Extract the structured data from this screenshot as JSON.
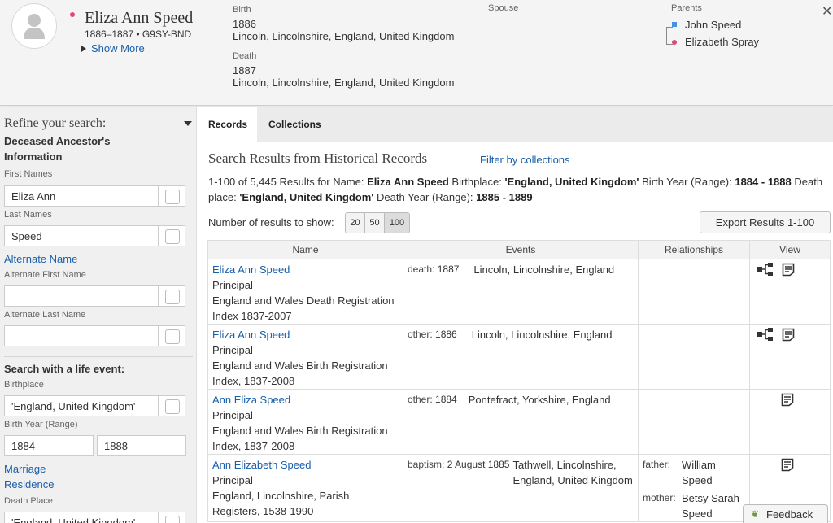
{
  "person": {
    "name": "Eliza Ann Speed",
    "meta": "1886–1887 • G9SY-BND",
    "show_more": "Show More",
    "birth_label": "Birth",
    "birth_date": "1886",
    "birth_place": "Lincoln, Lincolnshire, England, United Kingdom",
    "death_label": "Death",
    "death_date": "1887",
    "death_place": "Lincoln, Lincolnshire, England, United Kingdom",
    "spouse_label": "Spouse",
    "parents_label": "Parents",
    "father": "John Speed",
    "mother": "Elizabeth Spray"
  },
  "sidebar": {
    "refine_title": "Refine your search:",
    "deceased_title_1": "Deceased Ancestor's",
    "deceased_title_2": "Information",
    "first_names_label": "First Names",
    "first_names_value": "Eliza Ann",
    "last_names_label": "Last Names",
    "last_names_value": "Speed",
    "alternate_name": "Alternate Name",
    "alt_first_label": "Alternate First Name",
    "alt_last_label": "Alternate Last Name",
    "life_event_title": "Search with a life event:",
    "birthplace_label": "Birthplace",
    "birthplace_value": "'England, United Kingdom'",
    "birth_year_label": "Birth Year (Range)",
    "birth_year_from": "1884",
    "birth_year_to": "1888",
    "marriage": "Marriage",
    "residence": "Residence",
    "death_place_label": "Death Place",
    "death_place_value": "'England, United Kingdom'"
  },
  "tabs": {
    "records": "Records",
    "collections": "Collections"
  },
  "results": {
    "title": "Search Results from Historical Records",
    "filter": "Filter by collections",
    "summary_prefix": "1-100 of 5,445 Results for Name:",
    "summary_name": "Eliza Ann Speed",
    "summary_birthplace_label": "Birthplace:",
    "summary_birthplace": "'England, United Kingdom'",
    "summary_birthyear_label": "Birth Year (Range):",
    "summary_birthyear": "1884 - 1888",
    "summary_deathplace_label": "Death place:",
    "summary_deathplace": "'England, United Kingdom'",
    "summary_deathyear_label": "Death Year (Range):",
    "summary_deathyear": "1885 - 1889",
    "num_label": "Number of results to show:",
    "num_options": [
      "20",
      "50",
      "100"
    ],
    "export": "Export Results 1-100",
    "columns": {
      "name": "Name",
      "events": "Events",
      "relationships": "Relationships",
      "view": "View"
    },
    "rows": [
      {
        "name": "Eliza Ann Speed",
        "role": "Principal",
        "collection": "England and Wales Death Registration Index 1837-2007",
        "event_type": "death:",
        "event_date": "1887",
        "event_place": "Lincoln, Lincolnshire, England"
      },
      {
        "name": "Eliza Ann Speed",
        "role": "Principal",
        "collection": "England and Wales Birth Registration Index, 1837-2008",
        "event_type": "other:",
        "event_date": "1886",
        "event_place": "Lincoln, Lincolnshire, England"
      },
      {
        "name": "Ann Eliza Speed",
        "role": "Principal",
        "collection": "England and Wales Birth Registration Index, 1837-2008",
        "event_type": "other:",
        "event_date": "1884",
        "event_place": "Pontefract, Yorkshire, England"
      },
      {
        "name": "Ann Elizabeth Speed",
        "role": "Principal",
        "collection": "England, Lincolnshire, Parish Registers, 1538-1990",
        "event_type": "baptism:",
        "event_date": "2 August 1885",
        "event_place": "Tathwell, Lincolnshire, England, United Kingdom",
        "father_label": "father:",
        "father": "William Speed",
        "mother_label": "mother:",
        "mother": "Betsy Sarah Speed"
      }
    ]
  },
  "feedback": "Feedback"
}
